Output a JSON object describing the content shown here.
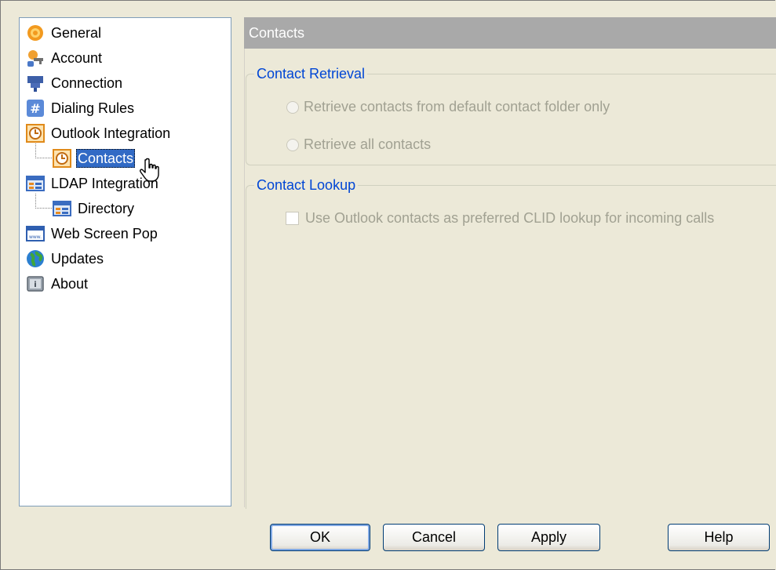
{
  "tree": {
    "items": [
      {
        "label": "General",
        "icon": "gear-icon"
      },
      {
        "label": "Account",
        "icon": "key-person-icon"
      },
      {
        "label": "Connection",
        "icon": "plug-icon"
      },
      {
        "label": "Dialing Rules",
        "icon": "hash-icon"
      },
      {
        "label": "Outlook Integration",
        "icon": "clock-icon"
      },
      {
        "label": "Contacts",
        "icon": "clock-icon",
        "selected": true
      },
      {
        "label": "LDAP Integration",
        "icon": "directory-icon"
      },
      {
        "label": "Directory",
        "icon": "directory-icon"
      },
      {
        "label": "Web Screen Pop",
        "icon": "web-window-icon"
      },
      {
        "label": "Updates",
        "icon": "globe-icon"
      },
      {
        "label": "About",
        "icon": "about-icon"
      }
    ]
  },
  "panel": {
    "title": "Contacts",
    "retrieval": {
      "title": "Contact Retrieval",
      "option1": "Retrieve contacts from default contact folder only",
      "option2": "Retrieve all contacts"
    },
    "lookup": {
      "title": "Contact Lookup",
      "checkbox_label": "Use Outlook contacts as preferred CLID lookup for incoming calls"
    }
  },
  "buttons": {
    "ok": "OK",
    "cancel": "Cancel",
    "apply": "Apply",
    "help": "Help"
  },
  "colors": {
    "selection": "#316ac5",
    "group_title": "#0046d5",
    "header_bar": "#a9a9a9",
    "disabled_text": "#a1a192"
  }
}
